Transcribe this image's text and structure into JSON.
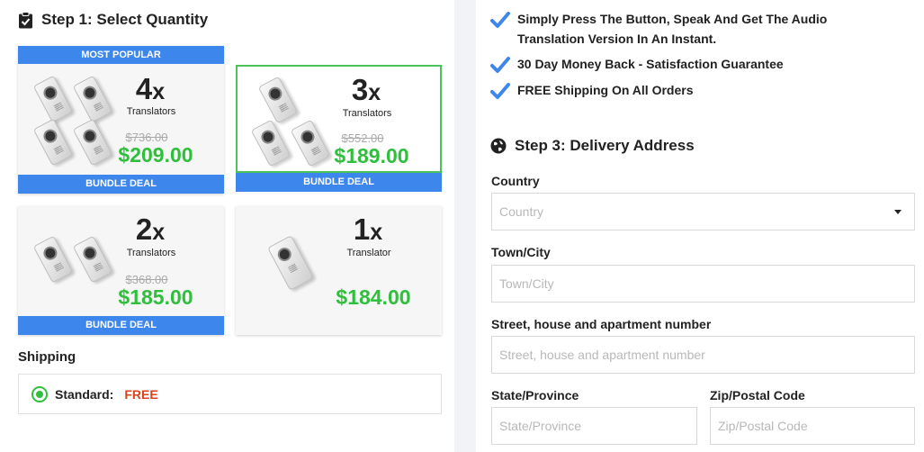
{
  "step1": {
    "title": "Step 1: Select Quantity"
  },
  "bundles": [
    {
      "qty": "4",
      "qty_suffix": "x",
      "unit": "Translators",
      "old_price": "$736.00",
      "price": "$209.00",
      "top_banner": "MOST POPULAR",
      "bottom_banner": "BUNDLE DEAL",
      "selected": false
    },
    {
      "qty": "3",
      "qty_suffix": "x",
      "unit": "Translators",
      "old_price": "$552.00",
      "price": "$189.00",
      "top_banner": "",
      "bottom_banner": "BUNDLE DEAL",
      "selected": true
    },
    {
      "qty": "2",
      "qty_suffix": "x",
      "unit": "Translators",
      "old_price": "$368.00",
      "price": "$185.00",
      "top_banner": "",
      "bottom_banner": "BUNDLE DEAL",
      "selected": false
    },
    {
      "qty": "1",
      "qty_suffix": "x",
      "unit": "Translator",
      "old_price": "",
      "price": "$184.00",
      "top_banner": "",
      "bottom_banner": "",
      "selected": false
    }
  ],
  "shipping": {
    "label": "Shipping",
    "option": "Standard:",
    "value": "FREE"
  },
  "benefits": [
    "Simply Press The Button, Speak And Get The Audio Translation Version In An Instant.",
    "30 Day Money Back - Satisfaction Guarantee",
    "FREE Shipping On All Orders"
  ],
  "step3": {
    "title": "Step 3: Delivery Address"
  },
  "form": {
    "country": {
      "label": "Country",
      "placeholder": "Country"
    },
    "city": {
      "label": "Town/City",
      "placeholder": "Town/City"
    },
    "street": {
      "label": "Street, house and apartment number",
      "placeholder": "Street, house and apartment number"
    },
    "state": {
      "label": "State/Province",
      "placeholder": "State/Province"
    },
    "zip": {
      "label": "Zip/Postal Code",
      "placeholder": "Zip/Postal Code"
    }
  },
  "colors": {
    "accent_blue": "#3d86ec",
    "price_green": "#2fbf3c",
    "free_red": "#d9421b",
    "selected_border": "#4cc25a"
  },
  "icons": {
    "step1": "clipboard-check-icon",
    "step3": "globe-icon",
    "benefit": "checkmark-icon",
    "product": "translator-device-image"
  }
}
